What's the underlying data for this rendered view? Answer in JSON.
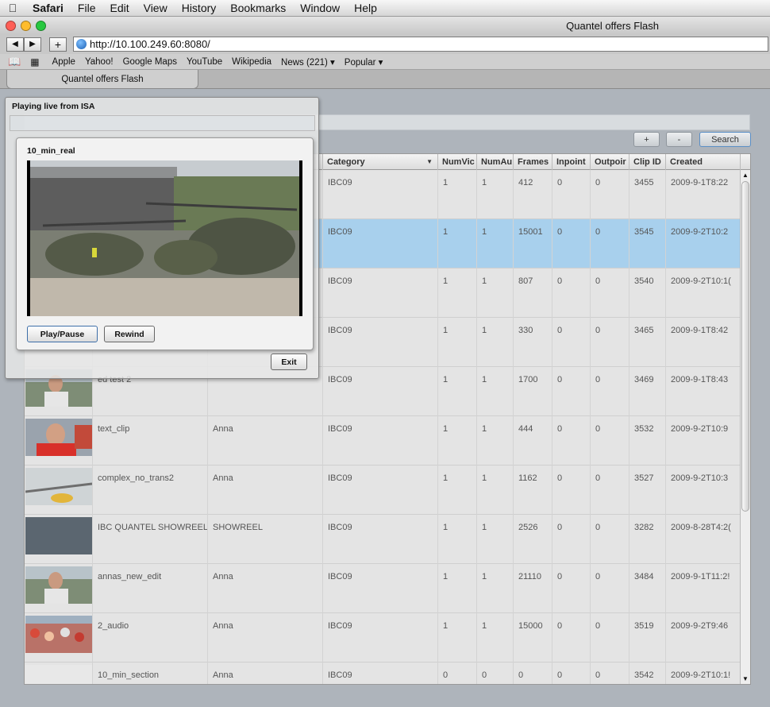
{
  "menubar": {
    "app": "Safari",
    "items": [
      "File",
      "Edit",
      "View",
      "History",
      "Bookmarks",
      "Window",
      "Help"
    ]
  },
  "window": {
    "title": "Quantel offers Flash"
  },
  "toolbar": {
    "url": "http://10.100.249.60:8080/",
    "back": "◀",
    "forward": "▶",
    "add": "+"
  },
  "bookmarks": {
    "items": [
      "Apple",
      "Yahoo!",
      "Google Maps",
      "YouTube",
      "Wikipedia",
      "News (221) ▾",
      "Popular ▾"
    ]
  },
  "tab": {
    "label": "Quantel offers Flash"
  },
  "search": {
    "plus_label": "+",
    "minus_label": "-",
    "search_label": "Search"
  },
  "table": {
    "columns": [
      "",
      "",
      "",
      "Category",
      "NumVic",
      "NumAu",
      "Frames",
      "Inpoint",
      "Outpoir",
      "Clip ID",
      "Created"
    ],
    "rows": [
      {
        "name": "",
        "user": "",
        "category": "IBC09",
        "numvid": "1",
        "numaud": "1",
        "frames": "412",
        "inpoint": "0",
        "outpoint": "0",
        "clipid": "3455",
        "created": "2009-9-1T8:22",
        "thumb": "none"
      },
      {
        "name": "",
        "user": "",
        "category": "IBC09",
        "numvid": "1",
        "numaud": "1",
        "frames": "15001",
        "inpoint": "0",
        "outpoint": "0",
        "clipid": "3545",
        "created": "2009-9-2T10:2",
        "thumb": "none",
        "selected": true
      },
      {
        "name": "",
        "user": "",
        "category": "IBC09",
        "numvid": "1",
        "numaud": "1",
        "frames": "807",
        "inpoint": "0",
        "outpoint": "0",
        "clipid": "3540",
        "created": "2009-9-2T10:1(",
        "thumb": "none"
      },
      {
        "name": "",
        "user": "",
        "category": "IBC09",
        "numvid": "1",
        "numaud": "1",
        "frames": "330",
        "inpoint": "0",
        "outpoint": "0",
        "clipid": "3465",
        "created": "2009-9-1T8:42",
        "thumb": "none"
      },
      {
        "name": "ed test 2",
        "user": "",
        "category": "IBC09",
        "numvid": "1",
        "numaud": "1",
        "frames": "1700",
        "inpoint": "0",
        "outpoint": "0",
        "clipid": "3469",
        "created": "2009-9-1T8:43",
        "thumb": "person-outdoor"
      },
      {
        "name": "text_clip",
        "user": "Anna",
        "category": "IBC09",
        "numvid": "1",
        "numaud": "1",
        "frames": "444",
        "inpoint": "0",
        "outpoint": "0",
        "clipid": "3532",
        "created": "2009-9-2T10:9",
        "thumb": "person-red"
      },
      {
        "name": "complex_no_trans2",
        "user": "Anna",
        "category": "IBC09",
        "numvid": "1",
        "numaud": "1",
        "frames": "1162",
        "inpoint": "0",
        "outpoint": "0",
        "clipid": "3527",
        "created": "2009-9-2T10:3",
        "thumb": "rotor"
      },
      {
        "name": "IBC QUANTEL SHOWREEL:",
        "user": "SHOWREEL",
        "category": "IBC09",
        "numvid": "1",
        "numaud": "1",
        "frames": "2526",
        "inpoint": "0",
        "outpoint": "0",
        "clipid": "3282",
        "created": "2009-8-28T4:2(",
        "thumb": "slate"
      },
      {
        "name": "annas_new_edit",
        "user": "Anna",
        "category": "IBC09",
        "numvid": "1",
        "numaud": "1",
        "frames": "21110",
        "inpoint": "0",
        "outpoint": "0",
        "clipid": "3484",
        "created": "2009-9-1T11:2!",
        "thumb": "person-outdoor"
      },
      {
        "name": "2_audio",
        "user": "Anna",
        "category": "IBC09",
        "numvid": "1",
        "numaud": "1",
        "frames": "15000",
        "inpoint": "0",
        "outpoint": "0",
        "clipid": "3519",
        "created": "2009-9-2T9:46",
        "thumb": "crowd"
      },
      {
        "name": "10_min_section",
        "user": "Anna",
        "category": "IBC09",
        "numvid": "0",
        "numaud": "0",
        "frames": "0",
        "inpoint": "0",
        "outpoint": "0",
        "clipid": "3542",
        "created": "2009-9-2T10:1!",
        "thumb": "broken"
      }
    ]
  },
  "overlay": {
    "title": "Playing live from ISA"
  },
  "player": {
    "title": "10_min_real",
    "play_label": "Play/Pause",
    "rewind_label": "Rewind",
    "exit_label": "Exit"
  },
  "colors": {
    "selected_row": "#a8d0ed",
    "content_bg": "#aeb4bb"
  }
}
